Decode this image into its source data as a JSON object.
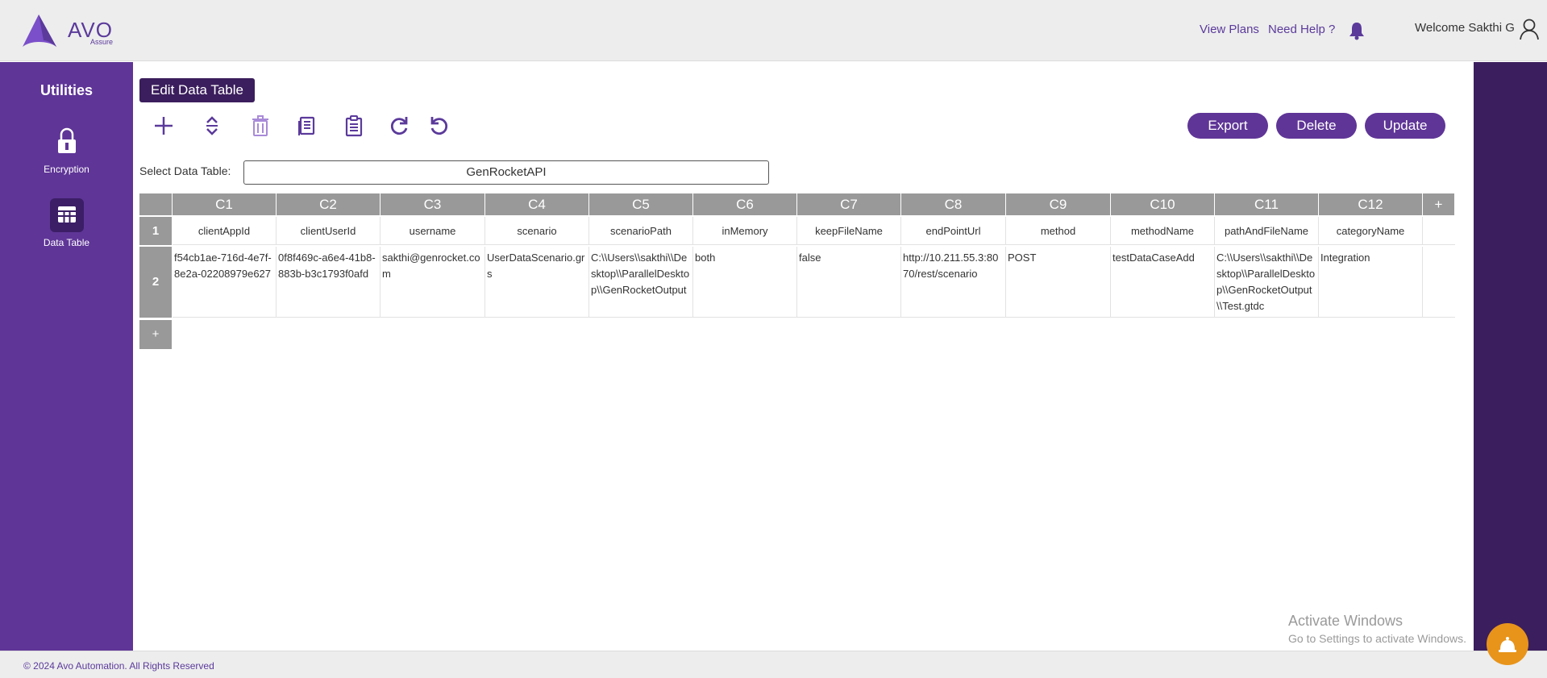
{
  "header": {
    "logo_text": "AVO",
    "logo_sub": "Assure",
    "view_plans": "View Plans",
    "need_help": "Need Help ?",
    "welcome": "Welcome Sakthi G",
    "bell_icon": "bell-icon",
    "user_icon": "user-icon"
  },
  "sidebar": {
    "title": "Utilities",
    "items": [
      {
        "label": "Encryption",
        "icon": "lock-icon"
      },
      {
        "label": "Data Table",
        "icon": "table-icon"
      }
    ]
  },
  "main": {
    "title": "Edit Data Table",
    "toolbar": [
      "add-icon",
      "move-icon",
      "trash-icon",
      "copy-icon",
      "paste-icon",
      "redo-icon",
      "undo-icon"
    ],
    "buttons": {
      "export": "Export",
      "delete": "Delete",
      "update": "Update"
    },
    "select_label": "Select Data Table:",
    "select_value": "GenRocketAPI"
  },
  "grid": {
    "columns": [
      "C1",
      "C2",
      "C3",
      "C4",
      "C5",
      "C6",
      "C7",
      "C8",
      "C9",
      "C10",
      "C11",
      "C12"
    ],
    "add_column": "+",
    "add_row": "+",
    "rows": [
      {
        "num": "1",
        "cells": [
          "clientAppId",
          "clientUserId",
          "username",
          "scenario",
          "scenarioPath",
          "inMemory",
          "keepFileName",
          "endPointUrl",
          "method",
          "methodName",
          "pathAndFileName",
          "categoryName"
        ]
      },
      {
        "num": "2",
        "cells": [
          "f54cb1ae-716d-4e7f-8e2a-02208979e627",
          "0f8f469c-a6e4-41b8-883b-b3c1793f0afd",
          "sakthi@genrocket.com",
          "UserDataScenario.grs",
          "C:\\\\Users\\\\sakthi\\\\Desktop\\\\ParallelDesktop\\\\GenRocketOutput",
          "both",
          "false",
          "http://10.211.55.3:8070/rest/scenario",
          "POST",
          "testDataCaseAdd",
          "C:\\\\Users\\\\sakthi\\\\Desktop\\\\ParallelDesktop\\\\GenRocketOutput\\\\Test.gtdc",
          "Integration"
        ]
      }
    ]
  },
  "footer": {
    "text": "© 2024 Avo Automation. All Rights Reserved"
  },
  "overlay": {
    "activate_title": "Activate Windows",
    "activate_sub": "Go to Settings to activate Windows."
  },
  "colors": {
    "brand": "#5f3597",
    "brand_dark": "#3b1e5d",
    "grid_header": "#999999",
    "float_button": "#e8941a"
  }
}
